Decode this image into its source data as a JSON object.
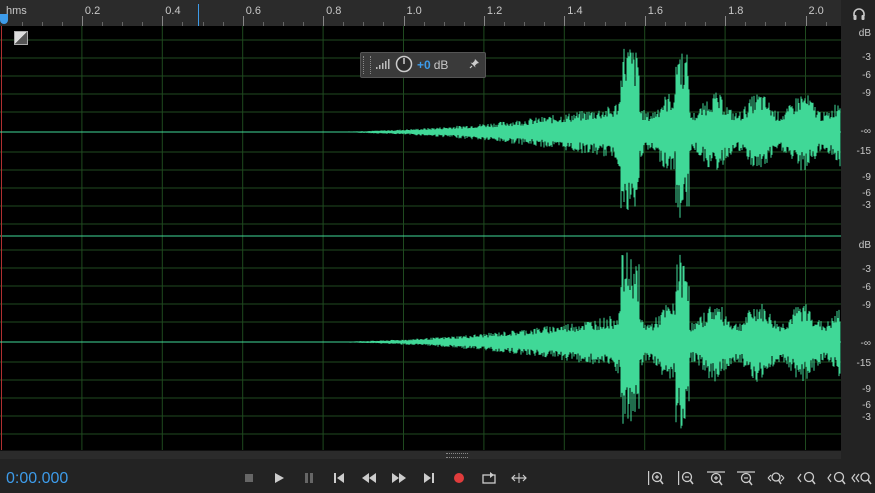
{
  "ruler": {
    "unit_label": "hms",
    "ticks": [
      "0.2",
      "0.4",
      "0.6",
      "0.8",
      "1.0",
      "1.2",
      "1.4",
      "1.6",
      "1.8",
      "2.0"
    ]
  },
  "db_scale": {
    "unit": "dB",
    "labels": [
      "-3",
      "-6",
      "-9",
      "-∞",
      "-15",
      "-9",
      "-6",
      "-3"
    ]
  },
  "hud": {
    "gain": "+0",
    "unit": "dB"
  },
  "transport": {
    "time": "0:00.000"
  },
  "colors": {
    "waveform": "#40d897",
    "accent": "#3d9be9",
    "record": "#e03c3c"
  }
}
